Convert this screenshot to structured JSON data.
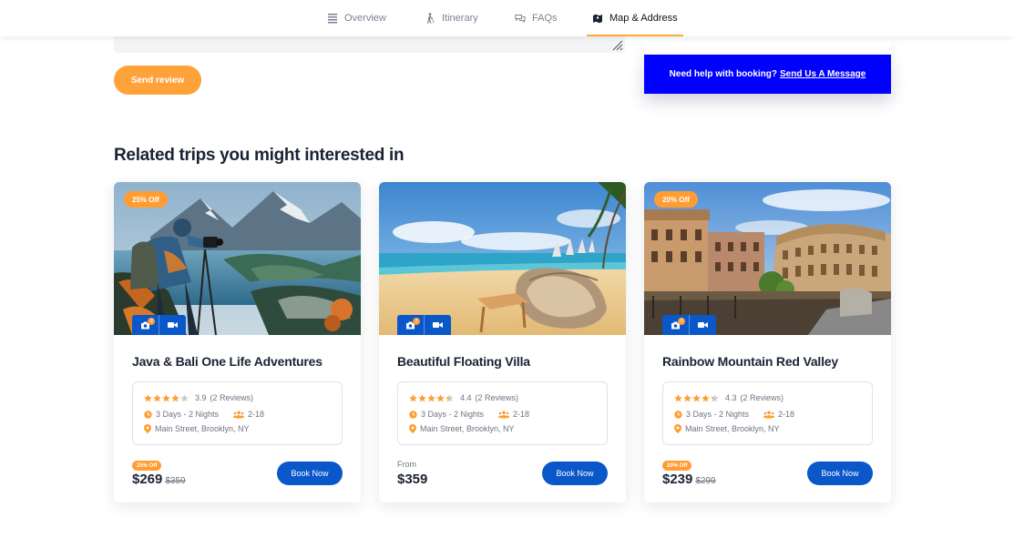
{
  "nav": {
    "tabs": [
      {
        "label": "Overview",
        "icon": "list-icon"
      },
      {
        "label": "Itinerary",
        "icon": "hiker-icon"
      },
      {
        "label": "FAQs",
        "icon": "chat-icon"
      },
      {
        "label": "Map & Address",
        "icon": "map-icon",
        "active": true
      }
    ]
  },
  "review": {
    "send_label": "Send review"
  },
  "help": {
    "text": "Need help with booking?",
    "link": "Send Us A Message"
  },
  "related": {
    "title": "Related trips you might interested in",
    "cards": [
      {
        "badge": "25% Off",
        "title": "Java & Bali One Life Adventures",
        "rating": "3.9",
        "reviews": "(2 Reviews)",
        "stars": 3.9,
        "duration": "3 Days - 2 Nights",
        "group": "2-18",
        "location": "Main Street, Brooklyn, NY",
        "price_label": "",
        "mini_badge": "25% Off",
        "price": "$269",
        "old_price": "$359",
        "book_label": "Book Now",
        "photo_count": "3"
      },
      {
        "badge": "",
        "title": "Beautiful Floating Villa",
        "rating": "4.4",
        "reviews": "(2 Reviews)",
        "stars": 4.4,
        "duration": "3 Days - 2 Nights",
        "group": "2-18",
        "location": "Main Street, Brooklyn, NY",
        "price_label": "From",
        "mini_badge": "",
        "price": "$359",
        "old_price": "",
        "book_label": "Book Now",
        "photo_count": "3"
      },
      {
        "badge": "20% Off",
        "title": "Rainbow Mountain Red Valley",
        "rating": "4.3",
        "reviews": "(2 Reviews)",
        "stars": 4.3,
        "duration": "3 Days - 2 Nights",
        "group": "2-18",
        "location": "Main Street, Brooklyn, NY",
        "price_label": "",
        "mini_badge": "20% Off",
        "price": "$239",
        "old_price": "$299",
        "book_label": "Book Now",
        "photo_count": "3"
      }
    ]
  },
  "colors": {
    "accent": "#ffa23a",
    "primary": "#0a57c9",
    "help_bg": "#0000ff",
    "star": "#ff9d33"
  }
}
